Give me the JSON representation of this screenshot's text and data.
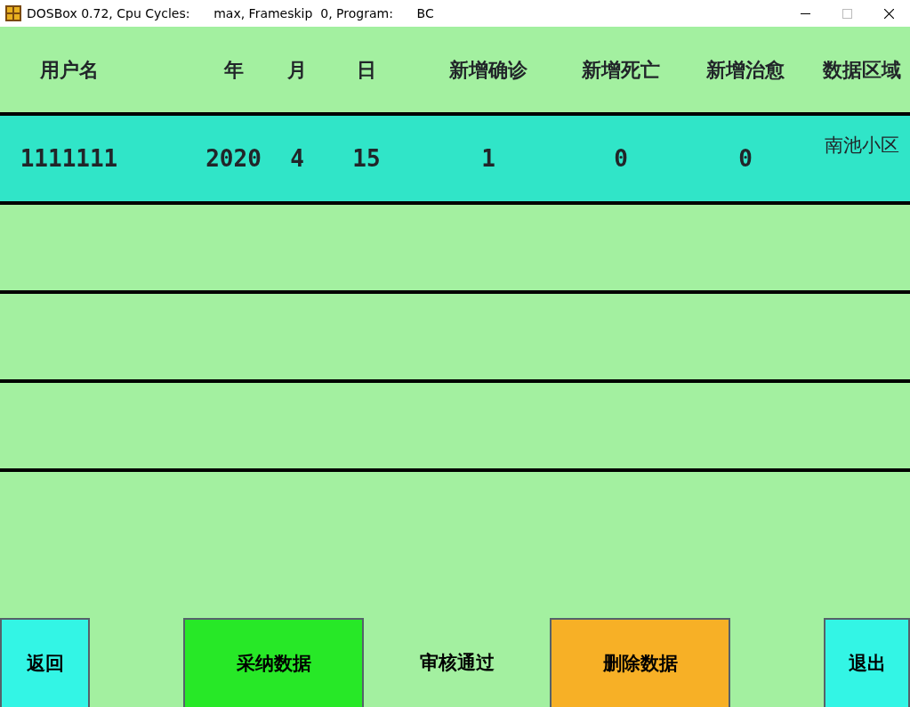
{
  "window": {
    "title": "DOSBox 0.72, Cpu Cycles:      max, Frameskip  0, Program:      BC"
  },
  "table": {
    "columns": [
      "用户名",
      "年",
      "月",
      "日",
      "新增确诊",
      "新增死亡",
      "新增治愈",
      "数据区域"
    ],
    "rows": [
      {
        "cells": [
          "1111111",
          "2020",
          "4",
          "15",
          "1",
          "0",
          "0",
          "南池小区"
        ],
        "selected": true
      }
    ]
  },
  "buttons": [
    {
      "label": "返回",
      "color": "#33f5e5"
    },
    {
      "label": "采纳数据",
      "color": "#27e827"
    },
    {
      "label": "审核通过"
    },
    {
      "label": "删除数据",
      "color": "#f7b026"
    },
    {
      "label": "退出",
      "color": "#33f5e5"
    }
  ]
}
